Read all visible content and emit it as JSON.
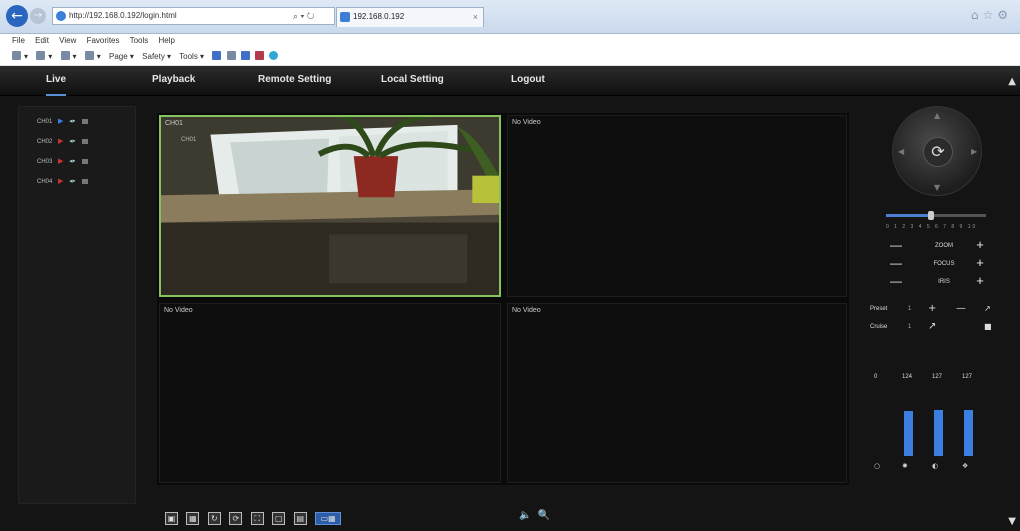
{
  "browser": {
    "url": "http://192.168.0.192/login.html",
    "tab_title": "192.168.0.192",
    "menu": [
      "File",
      "Edit",
      "View",
      "Favorites",
      "Tools",
      "Help"
    ],
    "commands": [
      "Page ▾",
      "Safety ▾",
      "Tools ▾"
    ]
  },
  "nav": {
    "items": [
      {
        "label": "Live",
        "active": true
      },
      {
        "label": "Playback",
        "active": false
      },
      {
        "label": "Remote Setting",
        "active": false
      },
      {
        "label": "Local Setting",
        "active": false
      },
      {
        "label": "Logout",
        "active": false
      }
    ]
  },
  "channels": [
    {
      "label": "CH01"
    },
    {
      "label": "CH02"
    },
    {
      "label": "CH03"
    },
    {
      "label": "CH04"
    }
  ],
  "tiles": [
    {
      "label": "CH01",
      "osd": "CH01",
      "active": true
    },
    {
      "label": "No Video",
      "active": false
    },
    {
      "label": "No Video",
      "active": false
    },
    {
      "label": "No Video",
      "active": false
    }
  ],
  "ptz": {
    "speed_ticks": "0 1 2 3 4 5 6 7 8 9 10",
    "speed_level": 0.45,
    "controls": [
      {
        "name": "ZOOM"
      },
      {
        "name": "FOCUS"
      },
      {
        "name": "IRIS"
      }
    ],
    "preset_label": "Preset",
    "preset_value": "1",
    "cruise_label": "Cruise",
    "cruise_value": "1",
    "color_values": [
      "0",
      "124",
      "127",
      "127"
    ],
    "color_levels": [
      0,
      0.62,
      0.64,
      0.64
    ]
  },
  "colors": {
    "accent": "#4d7fd0",
    "active_tile": "#86c35f",
    "background": "#141414"
  }
}
